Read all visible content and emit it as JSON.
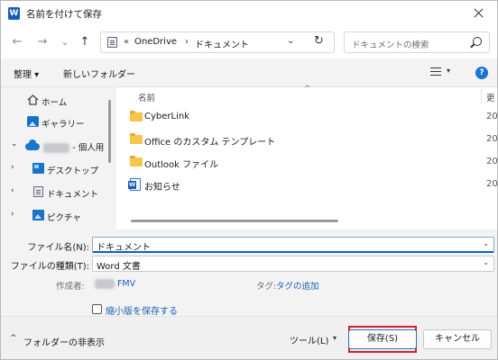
{
  "window": {
    "title": "名前を付けて保存",
    "app_icon": "W"
  },
  "nav": {
    "back": "←",
    "forward": "→",
    "recent": "⌄",
    "up": "↑",
    "address_prefix": "«",
    "address_segments": [
      "OneDrive",
      "ドキュメント"
    ],
    "address_sep": "›",
    "dropdown": "⌄",
    "refresh": "↻",
    "search_placeholder": "ドキュメントの検索"
  },
  "commandbar": {
    "organize": "整理 ▾",
    "new_folder": "新しいフォルダー",
    "view_dropdown": "▾",
    "help": "?"
  },
  "sidebar": {
    "items": [
      {
        "label": "ホーム",
        "icon": "home-icon",
        "chevron": ""
      },
      {
        "label": "ギャラリー",
        "icon": "gallery-icon",
        "chevron": ""
      },
      {
        "label": "- 個人用",
        "redacted": "████",
        "icon": "onedrive-cloud-icon",
        "chevron": "⌄"
      },
      {
        "label": "デスクトップ",
        "icon": "desktop-icon",
        "chevron": "›"
      },
      {
        "label": "ドキュメント",
        "icon": "documents-icon",
        "chevron": "›"
      },
      {
        "label": "ピクチャ",
        "icon": "pictures-icon",
        "chevron": "›"
      }
    ]
  },
  "filelist": {
    "column_name": "名前",
    "sort_indicator": "^",
    "column_date": "更",
    "rows": [
      {
        "name": "CyberLink",
        "type": "folder",
        "date": "20"
      },
      {
        "name": "Office のカスタム テンプレート",
        "type": "folder",
        "date": "20"
      },
      {
        "name": "Outlook ファイル",
        "type": "folder",
        "date": "20"
      },
      {
        "name": "お知らせ",
        "type": "word",
        "date": "20"
      }
    ]
  },
  "form": {
    "filename_label": "ファイル名(N):",
    "filename_value": "ドキュメント",
    "filetype_label": "ファイルの種類(T):",
    "filetype_value": "Word 文書",
    "author_label": "作成者:",
    "author_redacted": "███",
    "author_value": "FMV",
    "tags_label": "タグ:",
    "tags_link": "タグの追加",
    "thumbnail_label": "縮小版を保存する",
    "dropdown": "⌄"
  },
  "footer": {
    "hide_folders": "フォルダーの非表示",
    "hide_chevron": "^",
    "tools": "ツール(L)",
    "tools_dropdown": "▾",
    "save": "保存(S)",
    "cancel": "キャンセル"
  },
  "colors": {
    "accent": "#0067c0",
    "highlight_box": "#d61f27",
    "link": "#1a5fb4"
  }
}
